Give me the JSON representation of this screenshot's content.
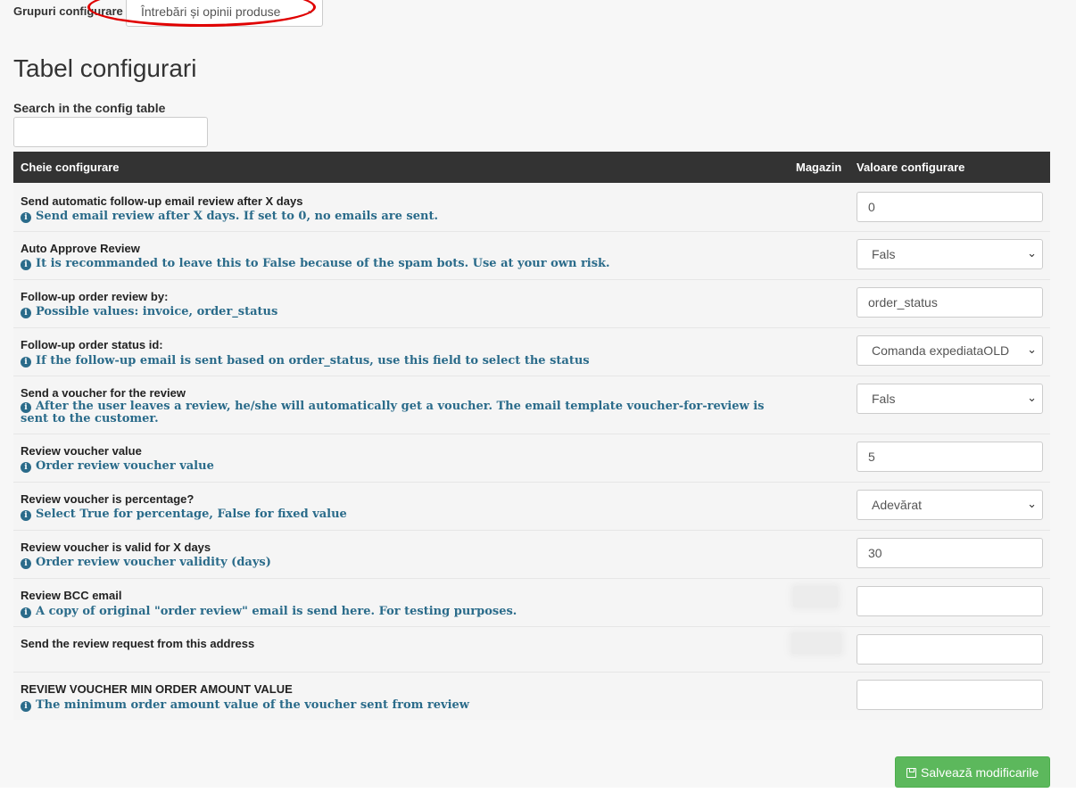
{
  "header": {
    "group_label": "Grupuri configurare",
    "group_value": "Întrebări și opinii produse",
    "title": "Tabel configurari",
    "search_label": "Search in the config table",
    "search_value": ""
  },
  "table": {
    "columns": [
      "Cheie configurare",
      "Magazin",
      "Valoare configurare"
    ],
    "rows": [
      {
        "key": "Send automatic follow-up email review after X days",
        "help": "Send email review after X days. If set to 0, no emails are sent.",
        "value": "0",
        "control": "input"
      },
      {
        "key": "Auto Approve Review",
        "help": "It is recommanded to leave this to False because of the spam bots. Use at your own risk.",
        "value": "Fals",
        "control": "select"
      },
      {
        "key": "Follow-up order review by:",
        "help": "Possible values: invoice, order_status",
        "value": "order_status",
        "control": "input"
      },
      {
        "key": "Follow-up order status id:",
        "help": "If the follow-up email is sent based on order_status, use this field to select the status",
        "value": "Comanda expediataOLD",
        "control": "select"
      },
      {
        "key": "Send a voucher for the review",
        "help": "After the user leaves a review, he/she will automatically get a voucher. The email template voucher-for-review is sent to the customer.",
        "value": "Fals",
        "control": "select"
      },
      {
        "key": "Review voucher value",
        "help": "Order review voucher value",
        "value": "5",
        "control": "input"
      },
      {
        "key": "Review voucher is percentage?",
        "help": "Select True for percentage, False for fixed value",
        "value": "Adevărat",
        "control": "select"
      },
      {
        "key": "Review voucher is valid for X days",
        "help": "Order review voucher validity (days)",
        "value": "30",
        "control": "input"
      },
      {
        "key": "Review BCC email",
        "help": "A copy of original \"order review\" email is send here. For testing purposes.",
        "value": "",
        "control": "input"
      },
      {
        "key": "Send the review request from this address",
        "help": "",
        "value": "",
        "control": "input"
      },
      {
        "key": "REVIEW VOUCHER MIN ORDER AMOUNT VALUE",
        "help": "The minimum order amount value of the voucher sent from review",
        "value": "",
        "control": "input"
      }
    ]
  },
  "footer": {
    "save_label": "Salvează modificarile"
  },
  "icons": {
    "info": "info-circle-icon",
    "save": "floppy-disk-icon",
    "dropdown": "chevron-down-icon"
  },
  "colors": {
    "header_bg": "#333333",
    "help_text": "#2a6b8a",
    "save_button": "#5cb85c",
    "annotation": "#e00000"
  }
}
